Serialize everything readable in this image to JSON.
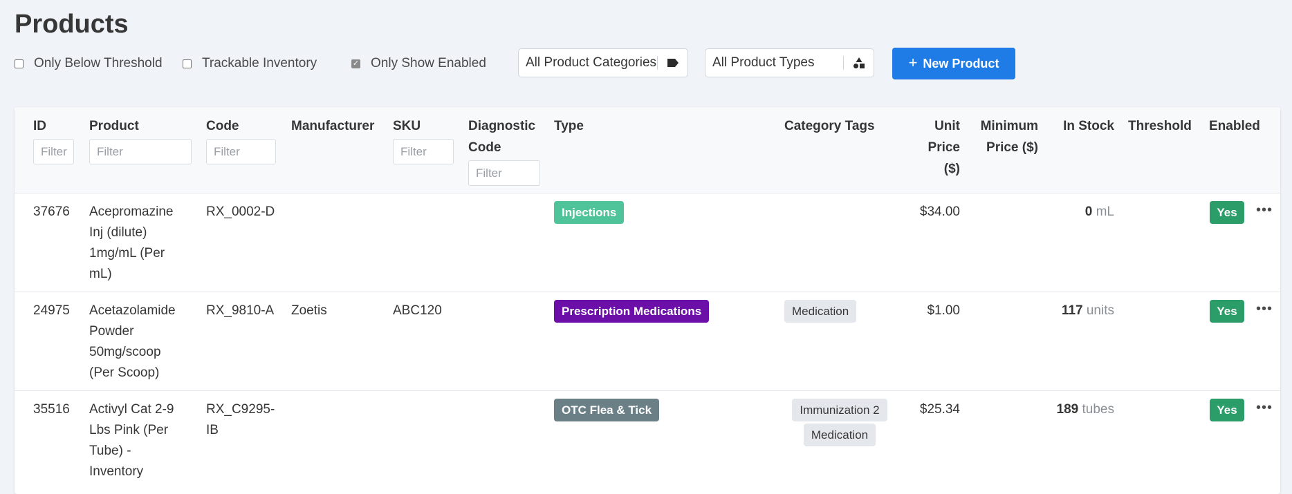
{
  "page": {
    "title": "Products"
  },
  "toolbar": {
    "filters": [
      {
        "label": "Only Below Threshold",
        "checked": false
      },
      {
        "label": "Trackable Inventory",
        "checked": false
      },
      {
        "label": "Only Show Enabled",
        "checked": true
      }
    ],
    "category_select": {
      "value": "All Product Categories",
      "icon": "tag-icon"
    },
    "type_select": {
      "value": "All Product Types",
      "icon": "shapes-icon"
    },
    "new_button": {
      "label": "New Product",
      "icon": "plus-icon"
    }
  },
  "table": {
    "headers": {
      "id": "ID",
      "product": "Product",
      "code": "Code",
      "manufacturer": "Manufacturer",
      "sku": "SKU",
      "diagnostic_code_1": "Diagnostic",
      "diagnostic_code_2": "Code",
      "type": "Type",
      "category_tags": "Category Tags",
      "unit_price_1": "Unit",
      "unit_price_2": "Price",
      "unit_price_3": "($)",
      "minimum_price_1": "Minimum",
      "minimum_price_2": "Price ($)",
      "in_stock": "In Stock",
      "threshold": "Threshold",
      "enabled": "Enabled"
    },
    "filter_placeholder": "Filter",
    "rows": [
      {
        "id": "37676",
        "product_lines": [
          "Acepromazine",
          "Inj (dilute)",
          "1mg/mL (Per",
          "mL)"
        ],
        "code_lines": [
          "RX_0002-D"
        ],
        "manufacturer": "",
        "sku": "",
        "type": "Injections",
        "type_color": "#4fc39a",
        "tags": [],
        "unit_price": "$34.00",
        "in_stock_qty": "0",
        "in_stock_unit": "mL",
        "enabled": "Yes"
      },
      {
        "id": "24975",
        "product_lines": [
          "Acetazolamide",
          "Powder",
          "50mg/scoop",
          "(Per Scoop)"
        ],
        "code_lines": [
          "RX_9810-A"
        ],
        "manufacturer": "Zoetis",
        "sku": "ABC120",
        "type": "Prescription Medications",
        "type_color": "#6b0fa8",
        "tags": [
          "Medication"
        ],
        "unit_price": "$1.00",
        "in_stock_qty": "117",
        "in_stock_unit": "units",
        "enabled": "Yes"
      },
      {
        "id": "35516",
        "product_lines": [
          "Activyl Cat 2-9",
          "Lbs Pink (Per",
          "Tube) -",
          "Inventory"
        ],
        "code_lines": [
          "RX_C9295-",
          "IB"
        ],
        "manufacturer": "",
        "sku": "",
        "type": "OTC Flea & Tick",
        "type_color": "#6b7f87",
        "tags": [
          "Immunization 2",
          "Medication"
        ],
        "unit_price": "$25.34",
        "in_stock_qty": "189",
        "in_stock_unit": "tubes",
        "enabled": "Yes"
      }
    ]
  }
}
